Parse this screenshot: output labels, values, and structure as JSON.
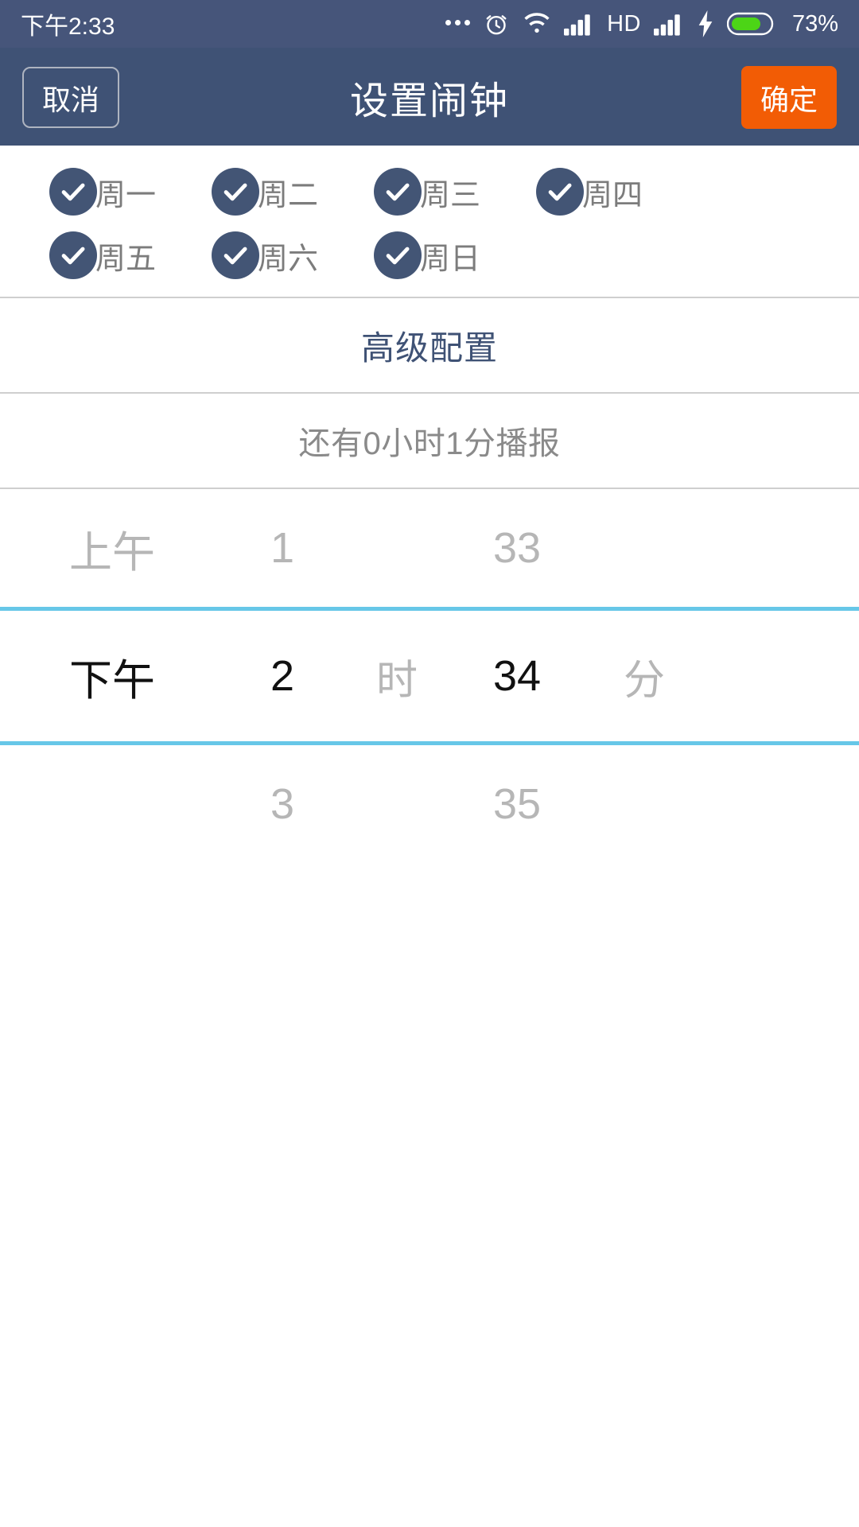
{
  "status_bar": {
    "time": "下午2:33",
    "battery_percent": "73%",
    "hd_label": "HD",
    "icons": [
      "more-dots-icon",
      "alarm-clock-icon",
      "wifi-icon",
      "signal-bars-icon",
      "hd-icon",
      "signal-bars-icon-2",
      "charging-bolt-icon",
      "battery-icon"
    ],
    "colors": {
      "background": "#46557A",
      "battery_fill": "#4CD516",
      "text": "#FFFFFF"
    }
  },
  "nav_bar": {
    "cancel_label": "取消",
    "title": "设置闹钟",
    "confirm_label": "确定",
    "colors": {
      "background": "#3F5275",
      "confirm_bg": "#F25C05",
      "cancel_border": "#AEB4C0",
      "text": "#FFFFFF"
    }
  },
  "weekdays": {
    "rows": [
      [
        {
          "label": "周一",
          "checked": true
        },
        {
          "label": "周二",
          "checked": true
        },
        {
          "label": "周三",
          "checked": true
        },
        {
          "label": "周四",
          "checked": true
        }
      ],
      [
        {
          "label": "周五",
          "checked": true
        },
        {
          "label": "周六",
          "checked": true
        },
        {
          "label": "周日",
          "checked": true
        }
      ]
    ],
    "colors": {
      "check_bg": "#435575",
      "check_mark": "#FFFFFF",
      "label": "#7C7C7C"
    }
  },
  "advanced": {
    "label": "高级配置",
    "color": "#3F5275"
  },
  "countdown": {
    "text": "还有0小时1分播报",
    "color": "#8A8A8A"
  },
  "time_picker": {
    "accent_color": "#67C7E8",
    "rows": {
      "above": {
        "ampm": "上午",
        "hour": "1",
        "hour_unit": "",
        "minute": "33",
        "minute_unit": ""
      },
      "selected": {
        "ampm": "下午",
        "hour": "2",
        "hour_unit": "时",
        "minute": "34",
        "minute_unit": "分"
      },
      "below": {
        "ampm": "",
        "hour": "3",
        "hour_unit": "",
        "minute": "35",
        "minute_unit": ""
      }
    }
  }
}
